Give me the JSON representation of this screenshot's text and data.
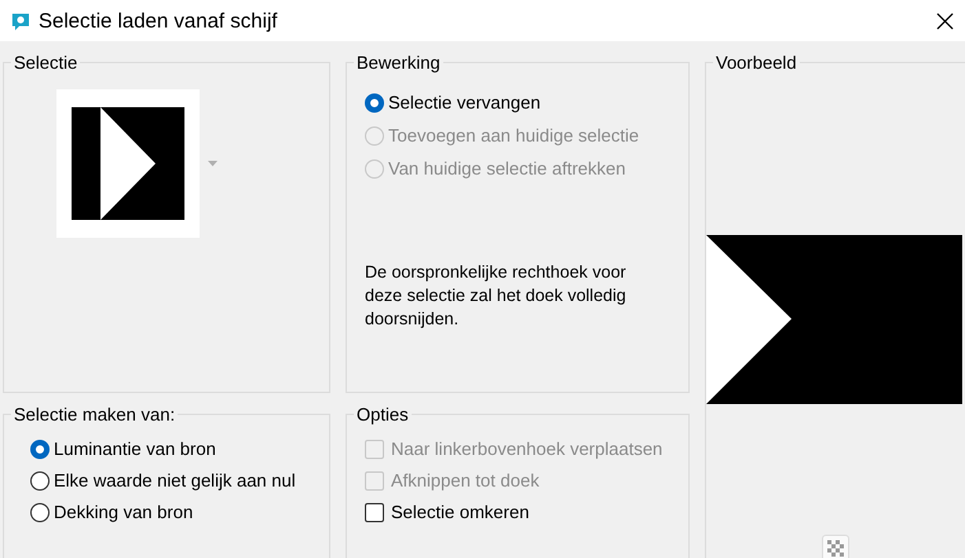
{
  "window": {
    "title": "Selectie laden vanaf schijf"
  },
  "selection": {
    "title": "Selectie"
  },
  "operation": {
    "title": "Bewerking",
    "options": [
      {
        "label": "Selectie vervangen",
        "selected": true,
        "disabled": false
      },
      {
        "label": "Toevoegen aan huidige selectie",
        "selected": false,
        "disabled": true
      },
      {
        "label": "Van huidige selectie aftrekken",
        "selected": false,
        "disabled": true
      }
    ],
    "note": "De oorspronkelijke rechthoek voor deze selectie zal het doek volledig doorsnijden."
  },
  "source": {
    "title": "Selectie maken van:",
    "options": [
      {
        "label": "Luminantie van bron",
        "selected": true,
        "disabled": false
      },
      {
        "label": "Elke waarde niet gelijk aan nul",
        "selected": false,
        "disabled": false
      },
      {
        "label": "Dekking van bron",
        "selected": false,
        "disabled": false
      }
    ]
  },
  "options": {
    "title": "Opties",
    "items": [
      {
        "label": "Naar linkerbovenhoek verplaatsen",
        "checked": false,
        "disabled": true
      },
      {
        "label": "Afknippen tot doek",
        "checked": false,
        "disabled": true
      },
      {
        "label": "Selectie omkeren",
        "checked": false,
        "disabled": false
      }
    ]
  },
  "preview": {
    "title": "Voorbeeld"
  }
}
